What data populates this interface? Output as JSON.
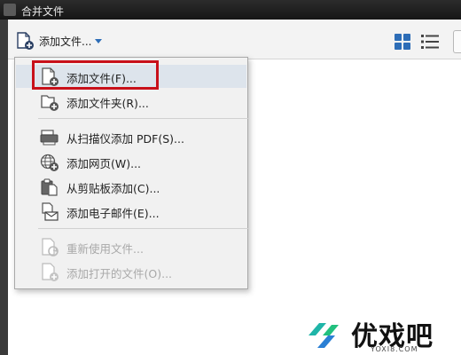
{
  "window": {
    "title": "合并文件"
  },
  "toolbar": {
    "add_files_label": "添加文件..."
  },
  "menu": {
    "items": [
      {
        "label": "添加文件(F)...",
        "icon": "add-file-icon",
        "state": "highlighted"
      },
      {
        "label": "添加文件夹(R)...",
        "icon": "add-folder-icon",
        "state": "enabled"
      },
      {
        "label": "从扫描仪添加 PDF(S)...",
        "icon": "scanner-icon",
        "state": "enabled"
      },
      {
        "label": "添加网页(W)...",
        "icon": "web-page-icon",
        "state": "enabled"
      },
      {
        "label": "从剪贴板添加(C)...",
        "icon": "clipboard-icon",
        "state": "enabled"
      },
      {
        "label": "添加电子邮件(E)...",
        "icon": "email-icon",
        "state": "enabled"
      },
      {
        "label": "重新使用文件...",
        "icon": "reuse-files-icon",
        "state": "disabled"
      },
      {
        "label": "添加打开的文件(O)...",
        "icon": "add-open-files-icon",
        "state": "disabled"
      }
    ]
  },
  "annotation": {
    "color": "#c8101a"
  },
  "watermark": {
    "text": "优戏吧",
    "url": "YOXI8.COM"
  },
  "colors": {
    "accent": "#2d6db7",
    "highlight": "#dde4ec"
  }
}
